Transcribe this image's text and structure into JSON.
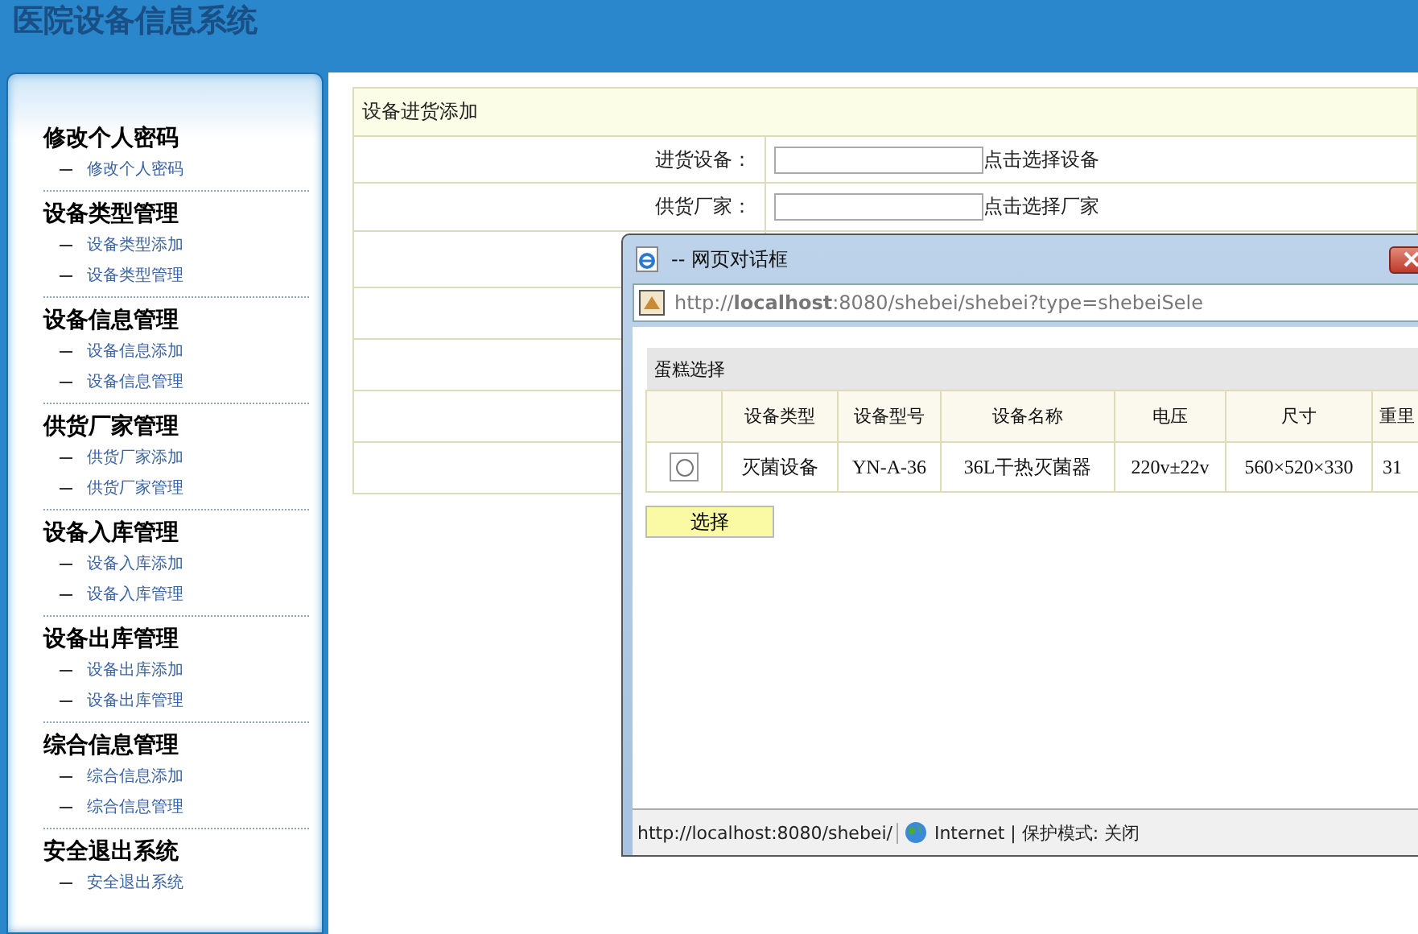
{
  "header": {
    "title": "医院设备信息系统"
  },
  "sidebar": {
    "groups": [
      {
        "title": "修改个人密码",
        "items": [
          "修改个人密码"
        ]
      },
      {
        "title": "设备类型管理",
        "items": [
          "设备类型添加",
          "设备类型管理"
        ]
      },
      {
        "title": "设备信息管理",
        "items": [
          "设备信息添加",
          "设备信息管理"
        ]
      },
      {
        "title": "供货厂家管理",
        "items": [
          "供货厂家添加",
          "供货厂家管理"
        ]
      },
      {
        "title": "设备入库管理",
        "items": [
          "设备入库添加",
          "设备入库管理"
        ]
      },
      {
        "title": "设备出库管理",
        "items": [
          "设备出库添加",
          "设备出库管理"
        ]
      },
      {
        "title": "综合信息管理",
        "items": [
          "综合信息添加",
          "综合信息管理"
        ]
      },
      {
        "title": "安全退出系统",
        "items": [
          "安全退出系统"
        ]
      }
    ]
  },
  "form": {
    "title": "设备进货添加",
    "rows": [
      {
        "kind": "field",
        "label": "进货设备：",
        "link": "点击选择设备"
      },
      {
        "kind": "field",
        "label": "供货厂家：",
        "link": "点击选择厂家"
      },
      {
        "kind": "blank"
      },
      {
        "kind": "blank"
      },
      {
        "kind": "blank"
      },
      {
        "kind": "blank"
      },
      {
        "kind": "blank"
      }
    ]
  },
  "dialog": {
    "title": "-- 网页对话框",
    "url": "http://**localhost**:8080/shebei/shebei?type=shebeiSele",
    "table": {
      "caption": "蛋糕选择",
      "columns": [
        "设备类型",
        "设备型号",
        "设备名称",
        "电压",
        "尺寸",
        "重里"
      ],
      "rows": [
        {
          "selected": false,
          "cells": [
            "灭菌设备",
            "YN-A-36",
            "36L干热灭菌器",
            "220v±22v",
            "560×520×330",
            "31"
          ]
        }
      ]
    },
    "button": "选择",
    "status_bar": {
      "url": "http://localhost:8080/shebei/",
      "zone": "Internet | 保护模式: 关闭"
    }
  }
}
